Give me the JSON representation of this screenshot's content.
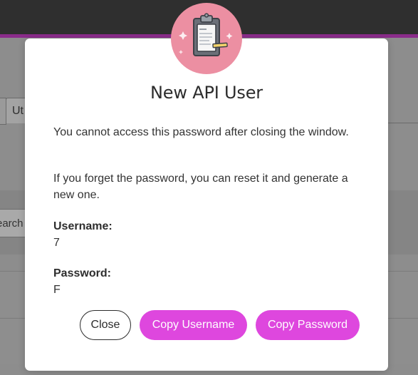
{
  "background": {
    "tab_label": "Ut",
    "search_text": "earch"
  },
  "dialog": {
    "title": "New API User",
    "warning": "You cannot access this password after closing the window.",
    "reset_info": "If you forget the password, you can reset it and generate a new one.",
    "username_label": "Username:",
    "username_value": "7",
    "password_label": "Password:",
    "password_value": "F",
    "close_label": "Close",
    "copy_username_label": "Copy Username",
    "copy_password_label": "Copy Password",
    "badge_icon": "clipboard-icon"
  },
  "colors": {
    "topbar": "#2f2f2f",
    "accent": "#8a2c8a",
    "primary_button": "#de47de",
    "badge": "#ec8fa2"
  }
}
